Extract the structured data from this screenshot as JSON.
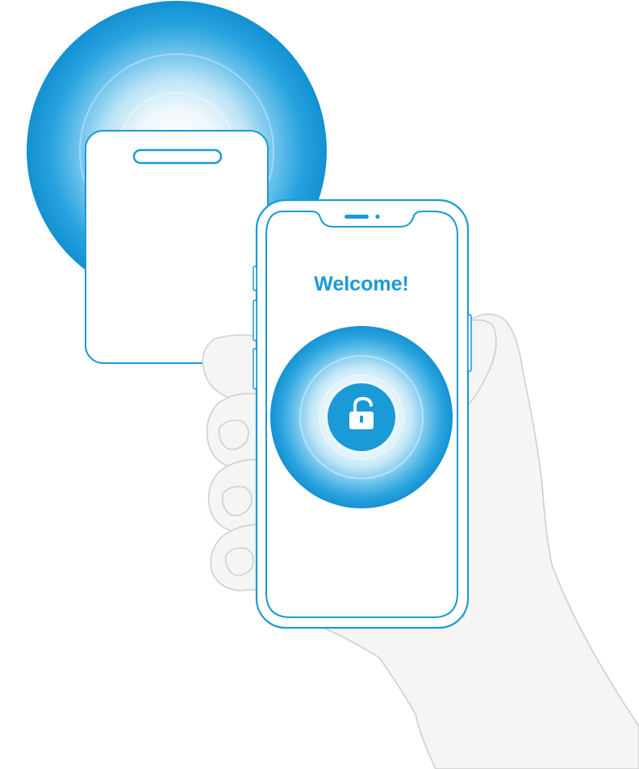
{
  "screen": {
    "welcome_text": "Welcome!"
  },
  "icons": {
    "unlock": "unlock-padlock-icon",
    "nfc_reader_slot": "card-slot-icon"
  },
  "colors": {
    "accent": "#1a9ad6",
    "accent_light": "#e6f5fc",
    "outline": "#1a9ad6",
    "hand_fill": "#f5f5f5",
    "hand_stroke": "#cfcfcf",
    "background": "#ffffff"
  }
}
